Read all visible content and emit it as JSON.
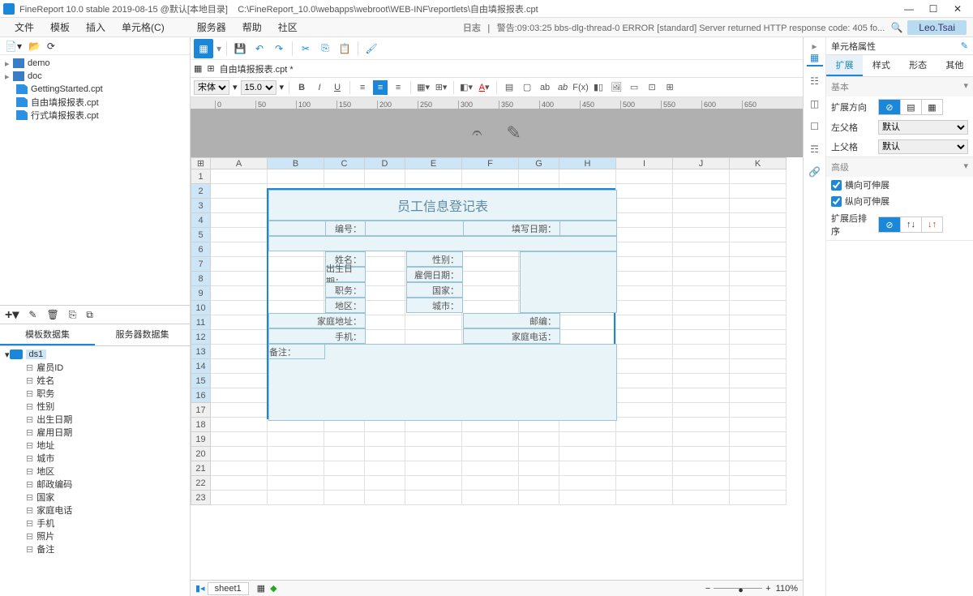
{
  "titlebar": {
    "app": "FineReport 10.0 stable 2019-08-15 @默认[本地目录]",
    "path": "C:\\FineReport_10.0\\webapps\\webroot\\WEB-INF\\reportlets\\自由填报报表.cpt"
  },
  "menu": {
    "file": "文件",
    "template": "模板",
    "insert": "插入",
    "cell": "单元格(C)",
    "server": "服务器",
    "help": "帮助",
    "community": "社区",
    "log_lbl": "日志",
    "log_msg": "警告:09:03:25 bbs-dlg-thread-0 ERROR [standard] Server returned HTTP response code: 405 fo...",
    "user": "Leo.Tsai"
  },
  "filetree": {
    "demo": "demo",
    "doc": "doc",
    "f1": "GettingStarted.cpt",
    "f2": "自由填报报表.cpt",
    "f3": "行式填报报表.cpt"
  },
  "ds": {
    "tab1": "模板数据集",
    "tab2": "服务器数据集",
    "name": "ds1",
    "cols": [
      "雇员ID",
      "姓名",
      "职务",
      "性别",
      "出生日期",
      "雇用日期",
      "地址",
      "城市",
      "地区",
      "邮政编码",
      "国家",
      "家庭电话",
      "手机",
      "照片",
      "备注"
    ]
  },
  "doc": {
    "tab": "自由填报报表.cpt *",
    "font": "宋体",
    "size": "15.0"
  },
  "grid": {
    "cols": [
      "A",
      "B",
      "C",
      "D",
      "E",
      "F",
      "G",
      "H",
      "I",
      "J",
      "K"
    ],
    "rows": 23
  },
  "form": {
    "title": "员工信息登记表",
    "r1a": "编号：",
    "r1b": "填写日期：",
    "r2a": "姓名：",
    "r2b": "性别：",
    "r3a": "出生日期：",
    "r3b": "雇佣日期：",
    "r4a": "职务：",
    "r4b": "国家：",
    "r5a": "地区：",
    "r5b": "城市：",
    "r6a": "家庭地址：",
    "r6b": "邮编：",
    "r7a": "手机：",
    "r7b": "家庭电话：",
    "r8": "备注："
  },
  "status": {
    "sheet": "sheet1",
    "zoom": "110%"
  },
  "props": {
    "title": "单元格属性",
    "tabs": {
      "expand": "扩展",
      "style": "样式",
      "shape": "形态",
      "other": "其他"
    },
    "sec1": "基本",
    "sec2": "高级",
    "dir": "扩展方向",
    "leftparent": "左父格",
    "topparent": "上父格",
    "default": "默认",
    "hstretch": "横向可伸展",
    "vstretch": "纵向可伸展",
    "sortafter": "扩展后排序"
  }
}
